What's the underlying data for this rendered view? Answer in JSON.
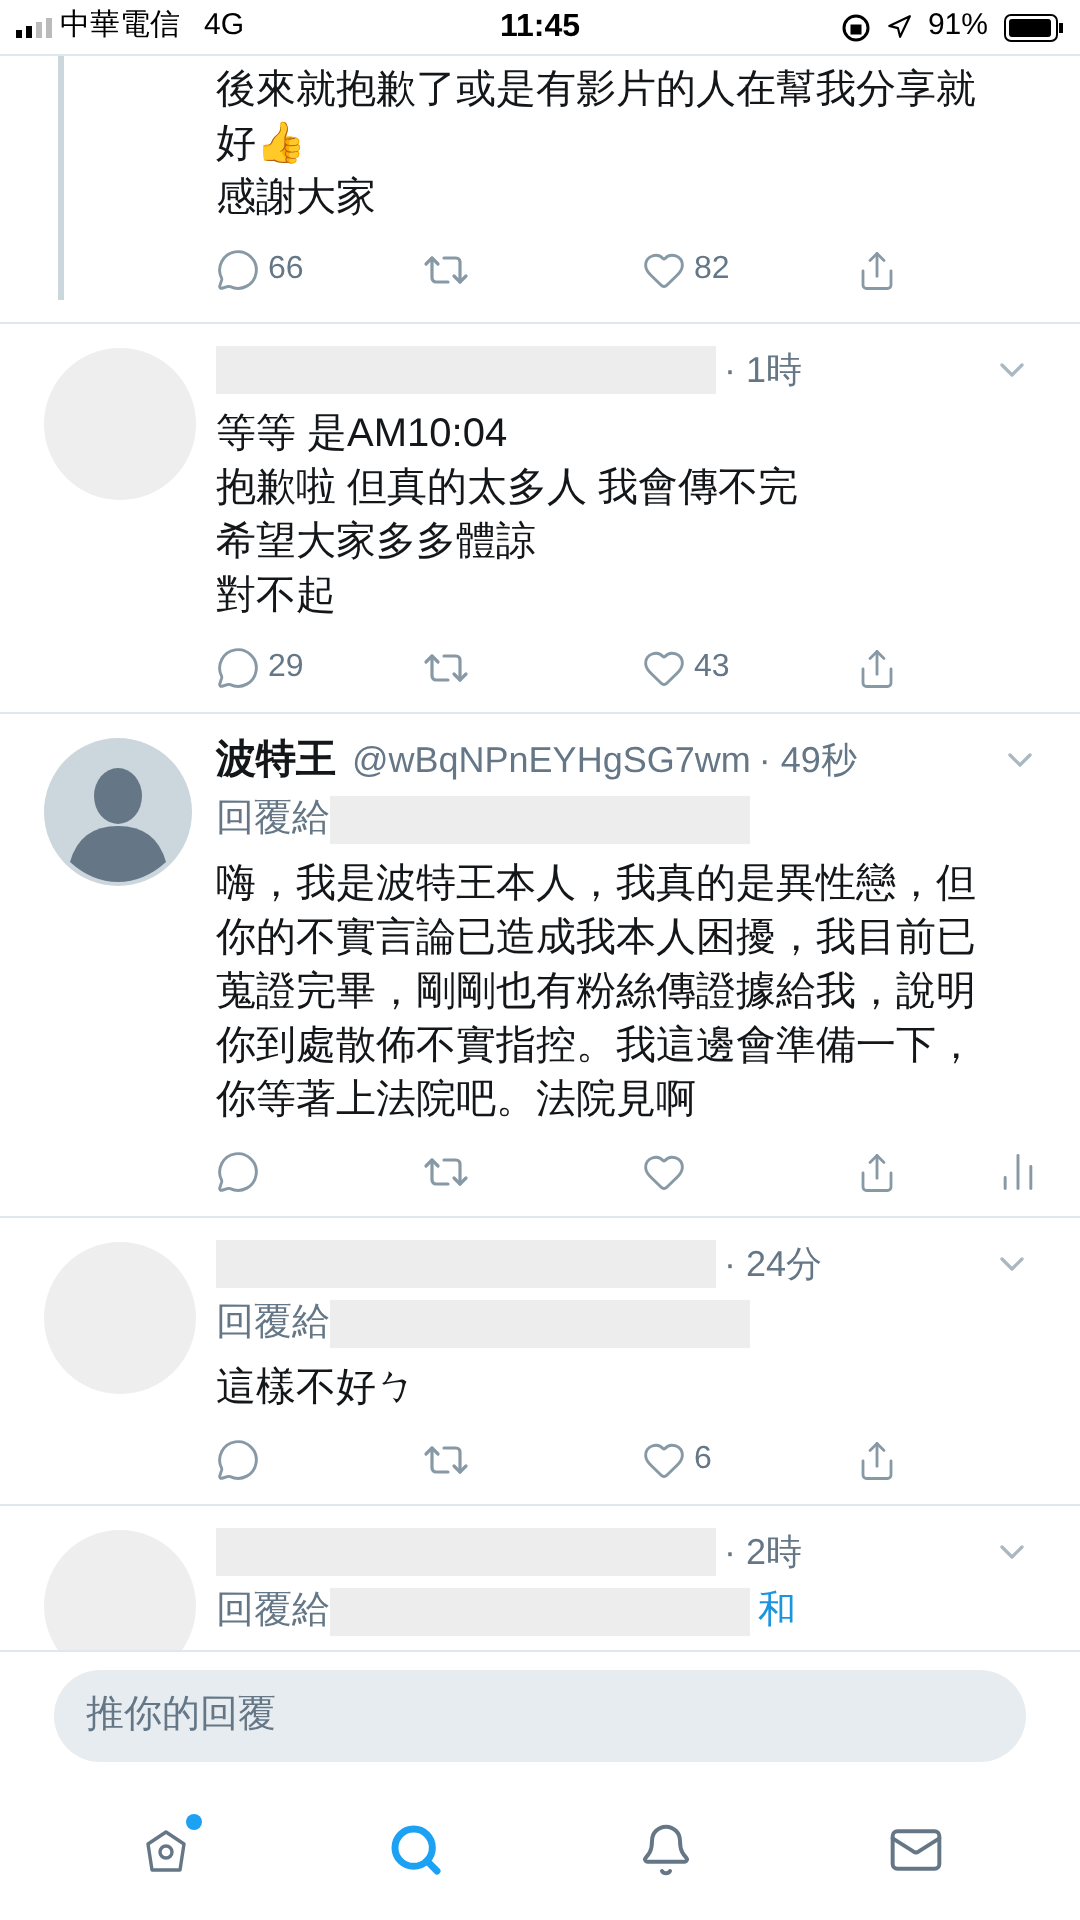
{
  "status_bar": {
    "carrier": "中華電信",
    "network": "4G",
    "time": "11:45",
    "battery": "91%"
  },
  "tweets": [
    {
      "kind": "continuation",
      "thread_line": true,
      "lines": [
        "後來就抱歉了或是有影片的人在幫我分享就",
        "好👍",
        "感謝大家"
      ],
      "replies": "66",
      "likes": "82"
    },
    {
      "kind": "reply",
      "default_avatar": false,
      "name_redacted": true,
      "time": "· 1時",
      "lines": [
        "等等 是AM10:04",
        "抱歉啦  但真的太多人 我會傳不完",
        "希望大家多多體諒",
        "對不起"
      ],
      "replies": "29",
      "likes": "43"
    },
    {
      "kind": "reply",
      "default_avatar": true,
      "name": "波特王",
      "handle": "@wBqNPnEYHgSG7wm",
      "time": "· 49秒",
      "reply_to": "回覆給",
      "lines": [
        "嗨，我是波特王本人，我真的是異性戀，但",
        "你的不實言論已造成我本人困擾，我目前已",
        "蒐證完畢，剛剛也有粉絲傳證據給我，說明",
        "你到處散佈不實指控。我這邊會準備一下，",
        "你等著上法院吧。法院見啊"
      ],
      "analytics": true
    },
    {
      "kind": "reply",
      "default_avatar": false,
      "name_redacted": true,
      "time": "· 24分",
      "reply_to": "回覆給",
      "lines": [
        "這樣不好ㄅ"
      ],
      "likes": "6"
    },
    {
      "kind": "reply",
      "default_avatar": false,
      "name_redacted": true,
      "time": "· 2時",
      "reply_to": "回覆給",
      "reply_to_suffix": "和",
      "cut": true
    }
  ],
  "composer": {
    "placeholder": "推你的回覆"
  },
  "tabs": [
    {
      "kind": "home",
      "selected": false,
      "badge": true
    },
    {
      "kind": "search",
      "selected": true,
      "badge": false
    },
    {
      "kind": "bell",
      "selected": false,
      "badge": false
    },
    {
      "kind": "mail",
      "selected": false,
      "badge": false
    }
  ]
}
